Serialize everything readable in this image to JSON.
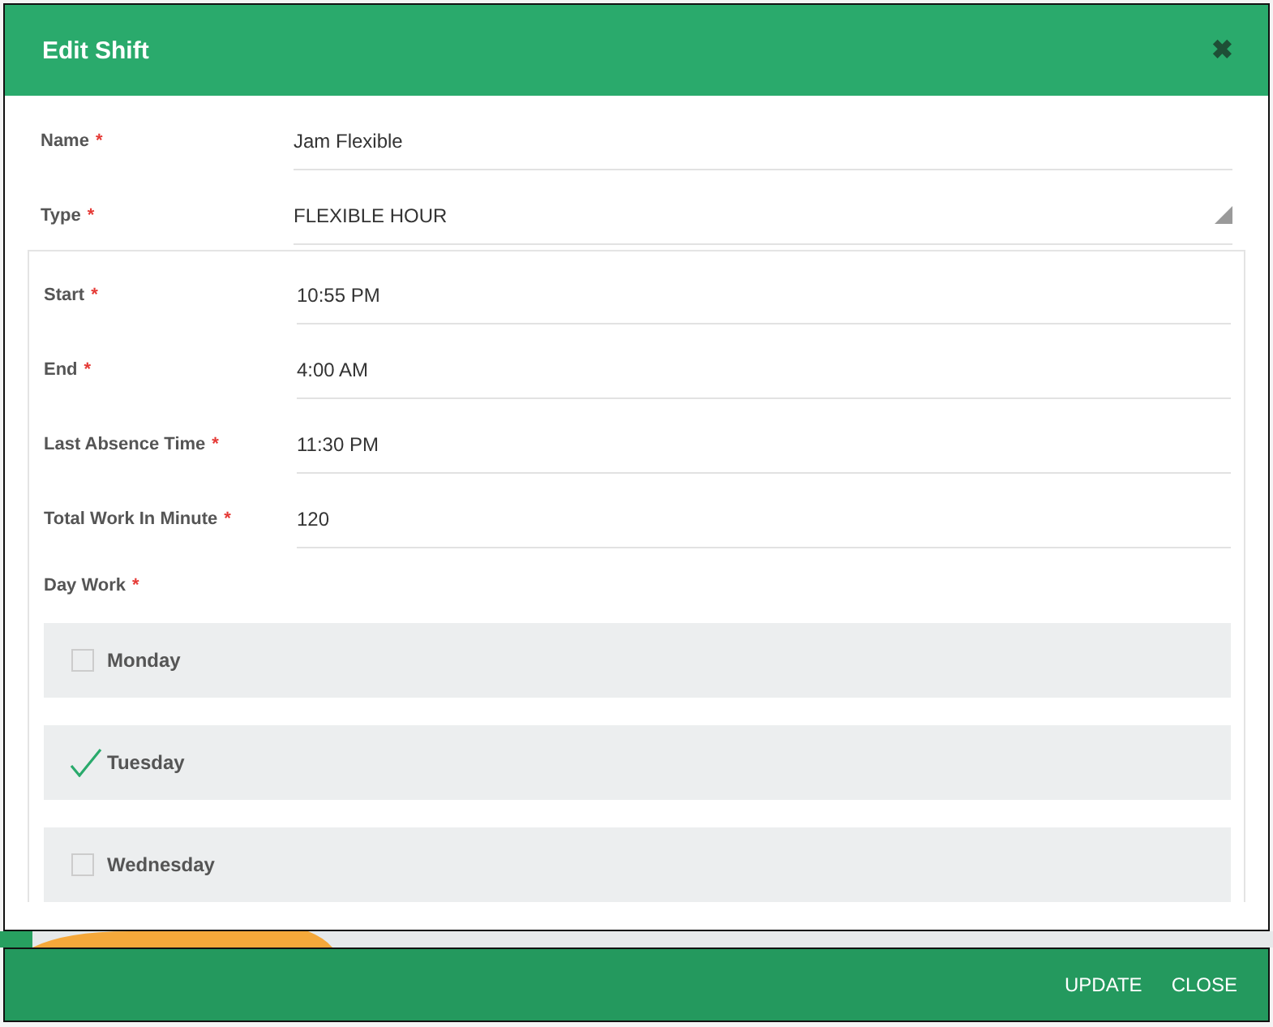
{
  "dialog": {
    "title": "Edit Shift",
    "close_icon": "✖"
  },
  "fields": [
    {
      "label": "Name",
      "mark": "*",
      "value": "Jam Flexible",
      "kind": "text"
    },
    {
      "label": "Type",
      "mark": "*",
      "value": "FLEXIBLE HOUR",
      "kind": "select"
    }
  ],
  "schedule": {
    "fields": [
      {
        "label": "Start",
        "mark": "*",
        "value": "10:55 PM"
      },
      {
        "label": "End",
        "mark": "*",
        "value": "4:00 AM"
      },
      {
        "label": "Last Absence Time",
        "mark": "*",
        "value": "11:30 PM"
      },
      {
        "label": "Total Work In Minute",
        "mark": "*",
        "value": "120"
      }
    ],
    "day_work": {
      "label": "Day Work",
      "mark": "*"
    },
    "days": [
      {
        "label": "Monday",
        "checked": false
      },
      {
        "label": "Tuesday",
        "checked": true
      },
      {
        "label": "Wednesday",
        "checked": false
      }
    ]
  },
  "footer": {
    "buttons": [
      "UPDATE",
      "CLOSE"
    ]
  }
}
